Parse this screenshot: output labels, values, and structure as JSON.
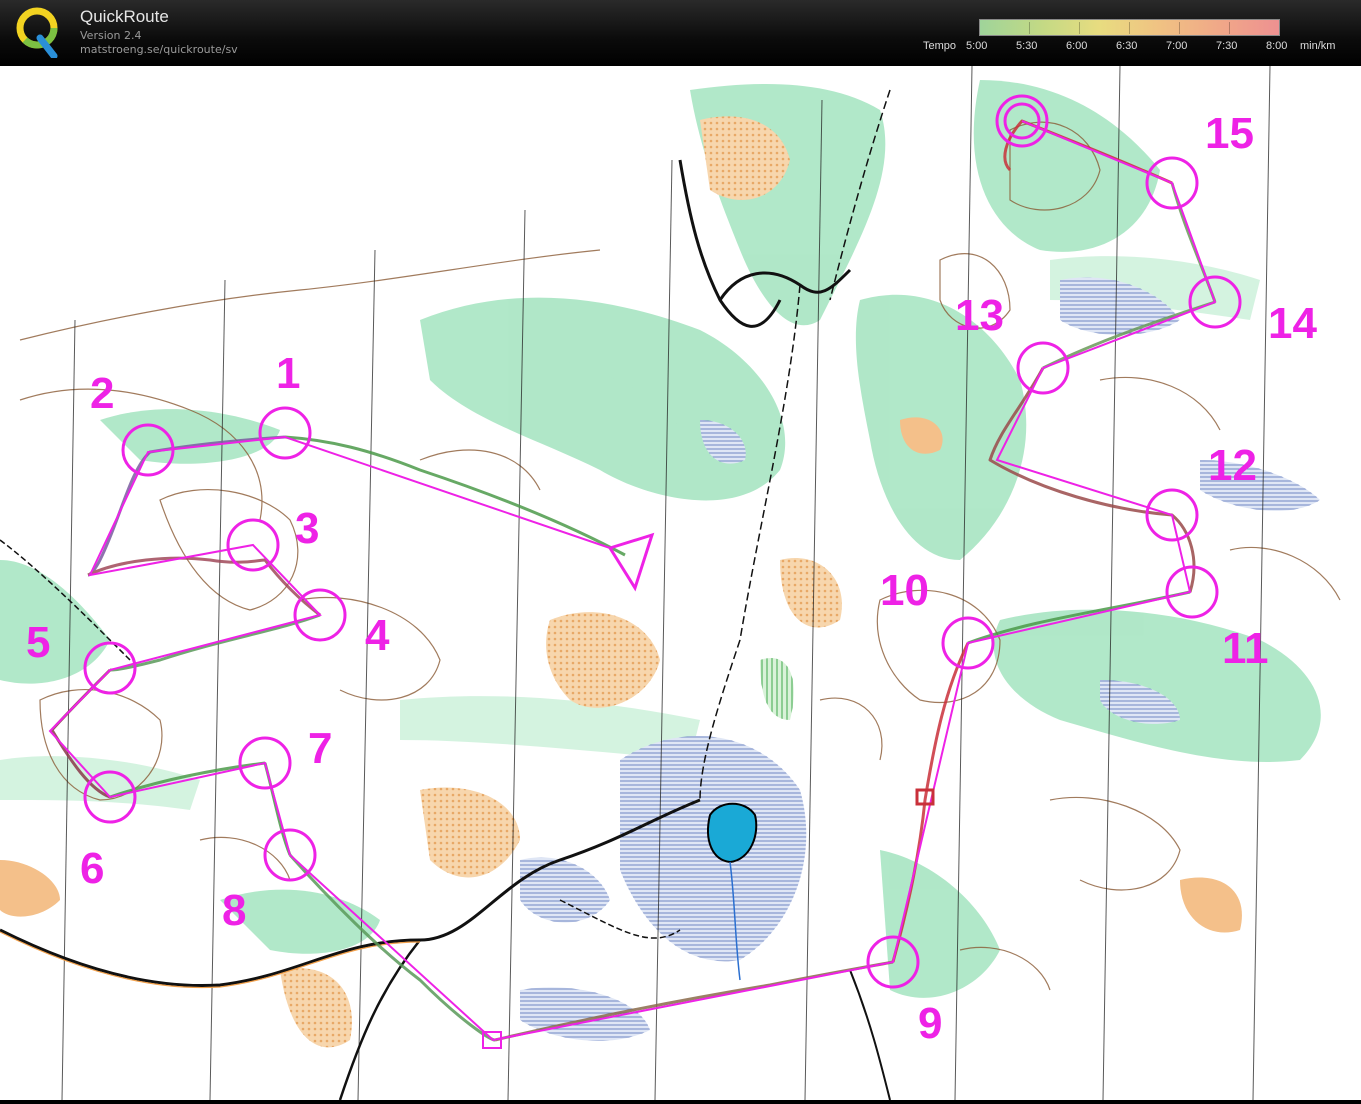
{
  "app": {
    "name": "QuickRoute",
    "version": "Version 2.4",
    "url": "matstroeng.se/quickroute/sv"
  },
  "legend": {
    "title": "Tempo",
    "labels": [
      "5:00",
      "5:30",
      "6:00",
      "6:30",
      "7:00",
      "7:30",
      "8:00"
    ],
    "unit": "min/km"
  },
  "colors": {
    "course": "#ee22e6",
    "route_fast": "#2f8f3f",
    "route_slow": "#c9303a",
    "forest_green": "#9be0b8",
    "open_land": "#f2b87a",
    "marsh": "#7f95c9",
    "lake": "#1aa9d6",
    "contour": "#8a5a34"
  },
  "controls": [
    "1",
    "2",
    "3",
    "4",
    "5",
    "6",
    "7",
    "8",
    "9",
    "10",
    "11",
    "12",
    "13",
    "14",
    "15"
  ]
}
